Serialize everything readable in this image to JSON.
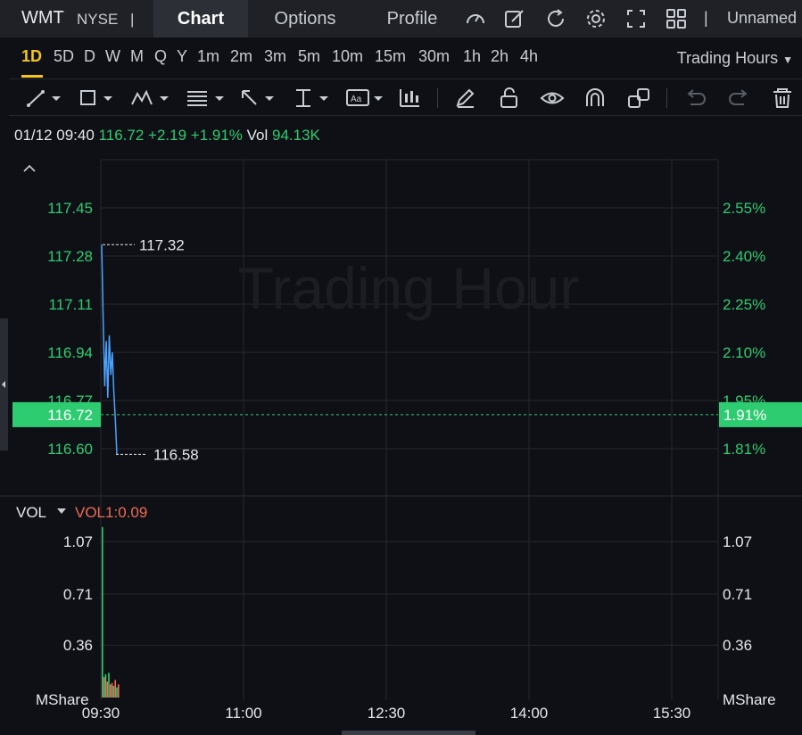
{
  "header": {
    "symbol": "WMT",
    "exchange": "NYSE",
    "separator": "|",
    "tabs": [
      {
        "label": "Chart",
        "active": true
      },
      {
        "label": "Options",
        "active": false
      },
      {
        "label": "Profile",
        "active": false
      }
    ],
    "icons": [
      "speedometer-icon",
      "edit-icon",
      "refresh-icon",
      "settings-icon",
      "fullscreen-icon",
      "grid-layout-icon"
    ],
    "layout_name": "Unnamed"
  },
  "timeframes": {
    "items": [
      "1D",
      "5D",
      "D",
      "W",
      "M",
      "Q",
      "Y",
      "1m",
      "2m",
      "3m",
      "5m",
      "10m",
      "15m",
      "30m",
      "1h",
      "2h",
      "4h"
    ],
    "active": "1D",
    "session_select": "Trading Hours"
  },
  "drawing_tools": [
    "trend-line-tool",
    "rectangle-tool",
    "pattern-tool",
    "fib-tool",
    "arrow-tool",
    "measure-tool",
    "text-tool",
    "indicator-tool",
    "pencil-tool",
    "lock-tool",
    "visibility-tool",
    "magnet-tool",
    "link-tool",
    "undo-tool",
    "redo-tool",
    "delete-tool"
  ],
  "quote": {
    "datetime": "01/12 09:40",
    "price": "116.72",
    "change": "+2.19",
    "change_pct": "+1.91%",
    "vol_label": "Vol",
    "vol_value": "94.13K"
  },
  "colors": {
    "up": "#2ecc71",
    "down": "#ef6a52",
    "line": "#4aa3ff",
    "accent": "#f5c518",
    "bg": "#0f1015"
  },
  "chart_data": [
    {
      "type": "line",
      "watermark": "Trading Hour",
      "y_ticks_left": [
        "117.45",
        "117.28",
        "117.11",
        "116.94",
        "116.77",
        "116.60"
      ],
      "y_ticks_right": [
        "2.55%",
        "2.40%",
        "2.25%",
        "2.10%",
        "1.95%",
        "1.81%"
      ],
      "ylim": [
        116.6,
        117.45
      ],
      "current_price_label": "116.72",
      "current_pct_label": "1.91%",
      "high_label": "117.32",
      "low_label": "116.58",
      "x": [
        "09:30",
        "09:31",
        "09:32",
        "09:33",
        "09:34",
        "09:35",
        "09:36",
        "09:37",
        "09:38",
        "09:39",
        "09:40"
      ],
      "values": [
        117.32,
        117.05,
        116.82,
        116.98,
        116.78,
        117.0,
        116.86,
        116.94,
        116.8,
        116.7,
        116.58
      ],
      "x_ticks": [
        "09:30",
        "11:00",
        "12:30",
        "14:00",
        "15:30"
      ]
    },
    {
      "type": "bar",
      "indicator_label": "VOL",
      "indicator_value": "VOL1:0.09",
      "y_ticks": [
        "1.07",
        "0.71",
        "0.36"
      ],
      "unit": "MShare",
      "ylim": [
        0,
        1.2
      ],
      "values": [
        1.17,
        0.14,
        0.16,
        0.11,
        0.17,
        0.09,
        0.1,
        0.08,
        0.12,
        0.07,
        0.09
      ],
      "directions": [
        "up",
        "down",
        "up",
        "down",
        "up",
        "down",
        "down",
        "up",
        "down",
        "up",
        "down"
      ]
    }
  ]
}
